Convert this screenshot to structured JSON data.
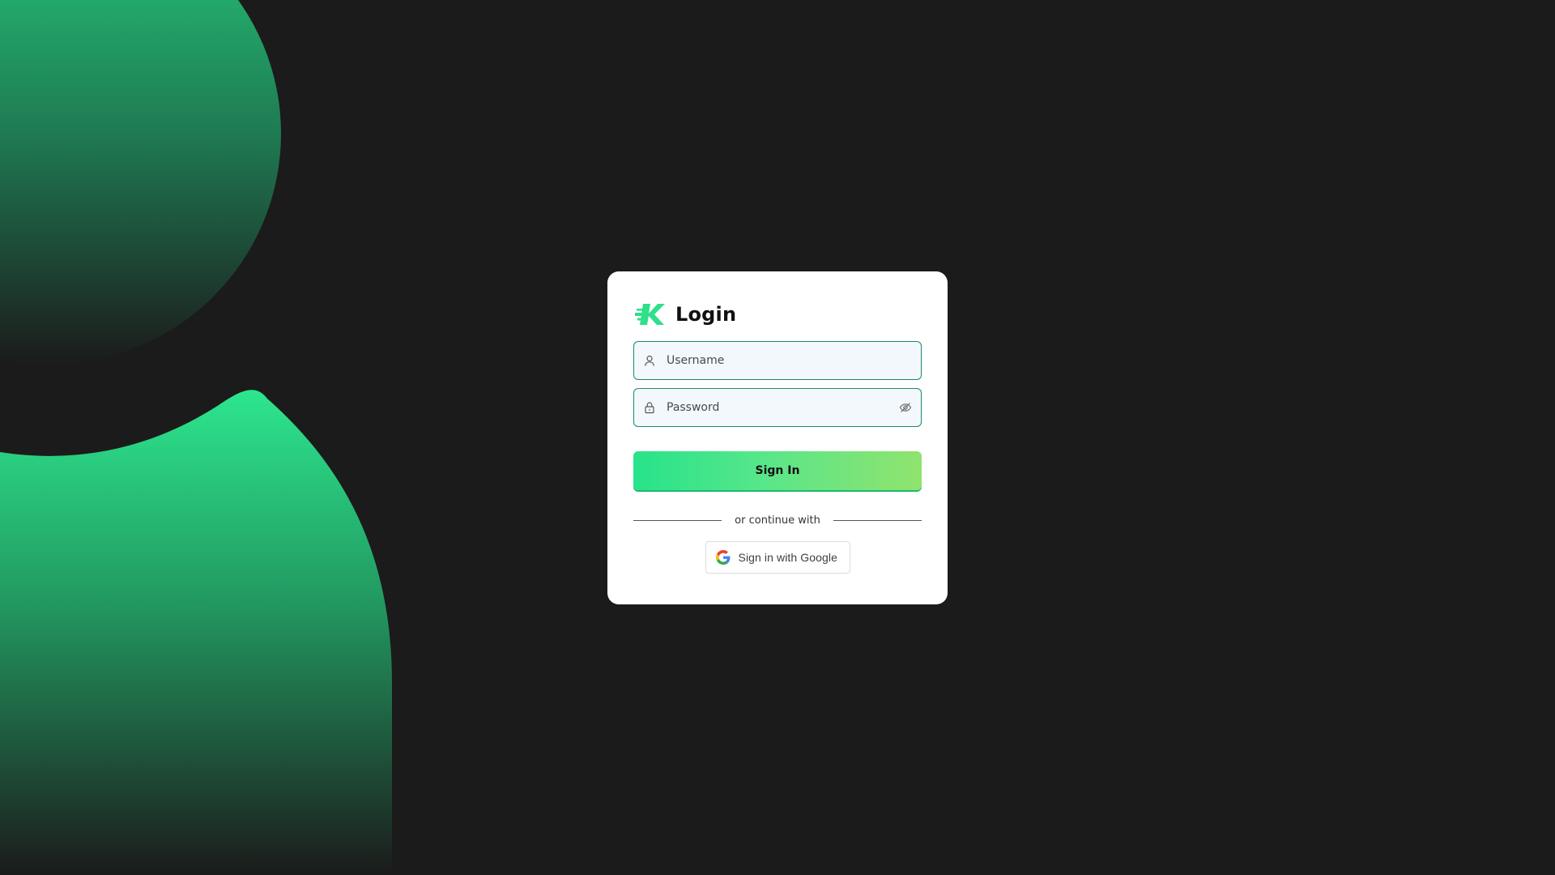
{
  "login": {
    "title": "Login",
    "username_placeholder": "Username",
    "password_placeholder": "Password",
    "sign_in_label": "Sign In",
    "divider_text": "or continue with",
    "google_label": "Sign in with Google"
  },
  "icons": {
    "brand": "brand-logo-icon",
    "username": "user-icon",
    "password": "lock-icon",
    "toggle_password": "eye-off-icon",
    "google": "google-g-icon"
  },
  "colors": {
    "background": "#1b1b1b",
    "accent_green": "#27e38a",
    "accent_light_green": "#90e36e",
    "field_border": "#1a8a6a",
    "field_background": "#f3f8fc"
  }
}
